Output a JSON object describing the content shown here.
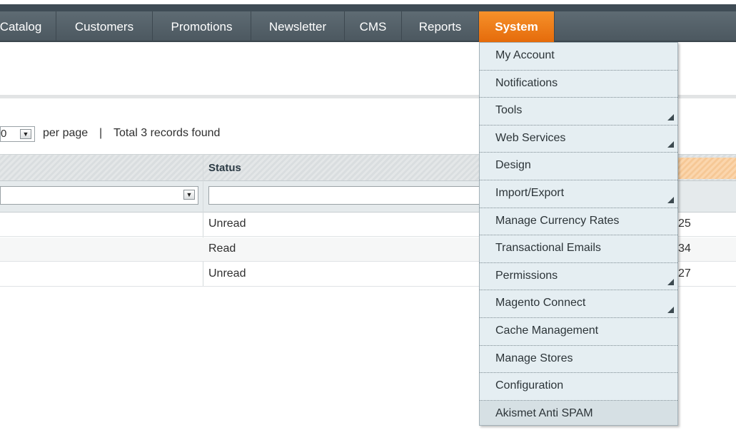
{
  "nav": {
    "items": [
      {
        "label": "Catalog",
        "active": false
      },
      {
        "label": "Customers",
        "active": false
      },
      {
        "label": "Promotions",
        "active": false
      },
      {
        "label": "Newsletter",
        "active": false
      },
      {
        "label": "CMS",
        "active": false
      },
      {
        "label": "Reports",
        "active": false
      },
      {
        "label": "System",
        "active": true
      }
    ]
  },
  "pager": {
    "per_page_value": "0",
    "per_page_label": "per page",
    "separator": "|",
    "total": "Total 3 records found"
  },
  "grid": {
    "status_header": "Status",
    "rows": [
      {
        "status": "Unread",
        "tail": "25"
      },
      {
        "status": "Read",
        "tail": "34"
      },
      {
        "status": "Unread",
        "tail": "27"
      }
    ]
  },
  "system_menu": {
    "items": [
      {
        "label": "My Account",
        "has_submenu": false
      },
      {
        "label": "Notifications",
        "has_submenu": false
      },
      {
        "label": "Tools",
        "has_submenu": true
      },
      {
        "label": "Web Services",
        "has_submenu": true
      },
      {
        "label": "Design",
        "has_submenu": false
      },
      {
        "label": "Import/Export",
        "has_submenu": true
      },
      {
        "label": "Manage Currency Rates",
        "has_submenu": false
      },
      {
        "label": "Transactional Emails",
        "has_submenu": false
      },
      {
        "label": "Permissions",
        "has_submenu": true
      },
      {
        "label": "Magento Connect",
        "has_submenu": true
      },
      {
        "label": "Cache Management",
        "has_submenu": false
      },
      {
        "label": "Manage Stores",
        "has_submenu": false
      },
      {
        "label": "Configuration",
        "has_submenu": false
      },
      {
        "label": "Akismet Anti SPAM",
        "has_submenu": false
      }
    ]
  },
  "colors": {
    "nav_bg": "#55626a",
    "active_tab": "#ef7f1a",
    "menu_bg": "#e5eef2"
  }
}
